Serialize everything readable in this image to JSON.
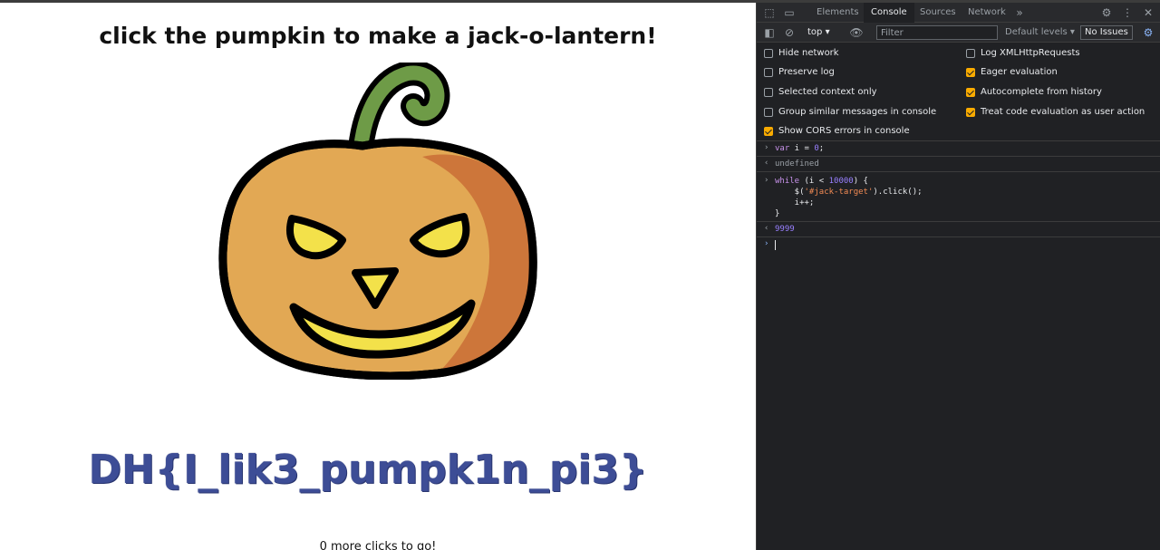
{
  "page": {
    "title": "click the pumpkin to make a jack-o-lantern!",
    "flag": "DH{I_lik3_pumpk1n_pi3}",
    "clicks_text": "0 more clicks to go!"
  },
  "colors": {
    "pumpkin_body": "#e2a854",
    "pumpkin_shade": "#cd763a",
    "stem": "#6e9b47",
    "eyes": "#f3e14a",
    "outline": "#000000",
    "flag": "#3d4d96"
  },
  "devtools": {
    "tabs": [
      {
        "label": "Elements",
        "active": false
      },
      {
        "label": "Console",
        "active": true
      },
      {
        "label": "Sources",
        "active": false
      },
      {
        "label": "Network",
        "active": false
      }
    ],
    "toolbar": {
      "context": "top",
      "filter_placeholder": "Filter",
      "levels": "Default levels",
      "issues": "No Issues"
    },
    "settings_left": [
      {
        "label": "Hide network",
        "checked": false
      },
      {
        "label": "Preserve log",
        "checked": false
      },
      {
        "label": "Selected context only",
        "checked": false
      },
      {
        "label": "Group similar messages in console",
        "checked": false
      },
      {
        "label": "Show CORS errors in console",
        "checked": true
      }
    ],
    "settings_right": [
      {
        "label": "Log XMLHttpRequests",
        "checked": false
      },
      {
        "label": "Eager evaluation",
        "checked": true
      },
      {
        "label": "Autocomplete from history",
        "checked": true
      },
      {
        "label": "Treat code evaluation as user action",
        "checked": true
      }
    ],
    "console": {
      "input1": {
        "kw": "var",
        "rest": " i = ",
        "num": "0",
        "end": ";"
      },
      "output1": "undefined",
      "input2": {
        "l1_kw": "while",
        "l1_mid": " (i < ",
        "l1_num": "10000",
        "l1_end": ") {",
        "l2_pre": "    $(",
        "l2_str": "'#jack-target'",
        "l2_end": ").click();",
        "l3": "    i++;",
        "l4": "}"
      },
      "output2": "9999"
    }
  }
}
